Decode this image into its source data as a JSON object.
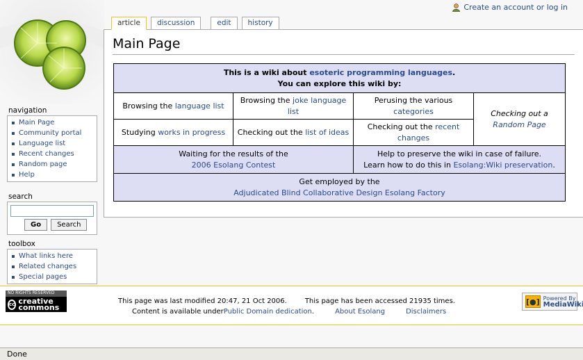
{
  "personal": {
    "label": "Create an account or log in"
  },
  "tabs": [
    {
      "label": "article",
      "selected": true
    },
    {
      "label": "discussion",
      "selected": false
    },
    {
      "label": "edit",
      "selected": false
    },
    {
      "label": "history",
      "selected": false
    }
  ],
  "page": {
    "title": "Main Page"
  },
  "table": {
    "header_line1_pre": "This is a wiki about ",
    "header_line1_link": "esoteric programming languages",
    "header_line1_post": ".",
    "header_line2": "You can explore this wiki by:",
    "r1c1_pre": "Browsing the ",
    "r1c1_link": "language list",
    "r1c2_pre": "Browsing the ",
    "r1c2_link": "joke language list",
    "r1c3_pre": "Perusing the various ",
    "r1c3_link": "categories",
    "r1c4_pre": "Checking out a ",
    "r1c4_link": "Random Page",
    "r2c1_pre": "Studying ",
    "r2c1_link": "works in progress",
    "r2c2_pre": "Checking out the ",
    "r2c2_link": "list of ideas",
    "r2c3_pre": "Checking out the ",
    "r2c3_link": "recent changes",
    "r3c1_line1": "Waiting for the results of the",
    "r3c1_link": "2006 Esolang Contest",
    "r3c2_line1": "Help to preserve the wiki in case of failure.",
    "r3c2_pre": "Learn how to do this in ",
    "r3c2_link": "Esolang:Wiki preservation",
    "r3c2_post": ".",
    "r4_line1": "Get employed by the",
    "r4_link": "Adjudicated Blind Collaborative Design Esolang Factory"
  },
  "navigation": {
    "heading": "navigation",
    "items": [
      "Main Page",
      "Community portal",
      "Language list",
      "Recent changes",
      "Random page",
      "Help"
    ]
  },
  "search": {
    "heading": "search",
    "value": "",
    "go_label": "Go",
    "search_label": "Search"
  },
  "toolbox": {
    "heading": "toolbox",
    "items": [
      "What links here",
      "Related changes",
      "Special pages"
    ]
  },
  "footer": {
    "cc_top": "NO RIGHTS RESERVED",
    "cc_main": "creative commons",
    "mw_small": "Powered By",
    "mw_big": "MediaWiki",
    "lastmod": "This page was last modified 20:47, 21 Oct 2006.",
    "accessed": "This page has been accessed 21935 times.",
    "content_pre": "Content is available under ",
    "content_link": "Public Domain dedication",
    "content_post": ".",
    "about": "About Esolang",
    "disclaimers": "Disclaimers"
  },
  "status": {
    "text": "Done"
  },
  "colors": {
    "link": "#2a4b8d",
    "table_blue": "#ddddf3",
    "tab_selected_border": "#fabd23"
  }
}
